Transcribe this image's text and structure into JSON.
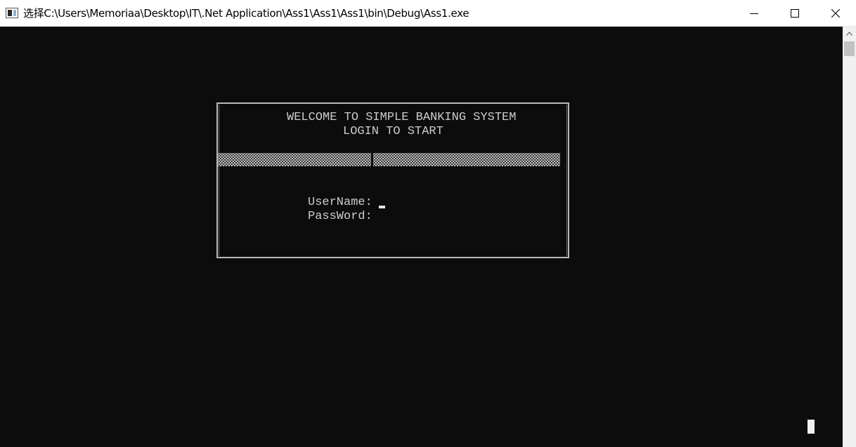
{
  "window": {
    "title": "选择C:\\Users\\Memoriaa\\Desktop\\IT\\.Net Application\\Ass1\\Ass1\\Ass1\\bin\\Debug\\Ass1.exe",
    "icon": "console-app-icon",
    "controls": {
      "minimize": "minimize-icon",
      "maximize": "maximize-icon",
      "close": "close-icon"
    }
  },
  "console": {
    "background": "#0c0c0c",
    "text_color": "#cccccc",
    "login": {
      "welcome": "WELCOME TO SIMPLE BANKING SYSTEM",
      "subtitle": "LOGIN TO START",
      "username_label": "UserName:",
      "password_label": "PassWord:"
    }
  }
}
